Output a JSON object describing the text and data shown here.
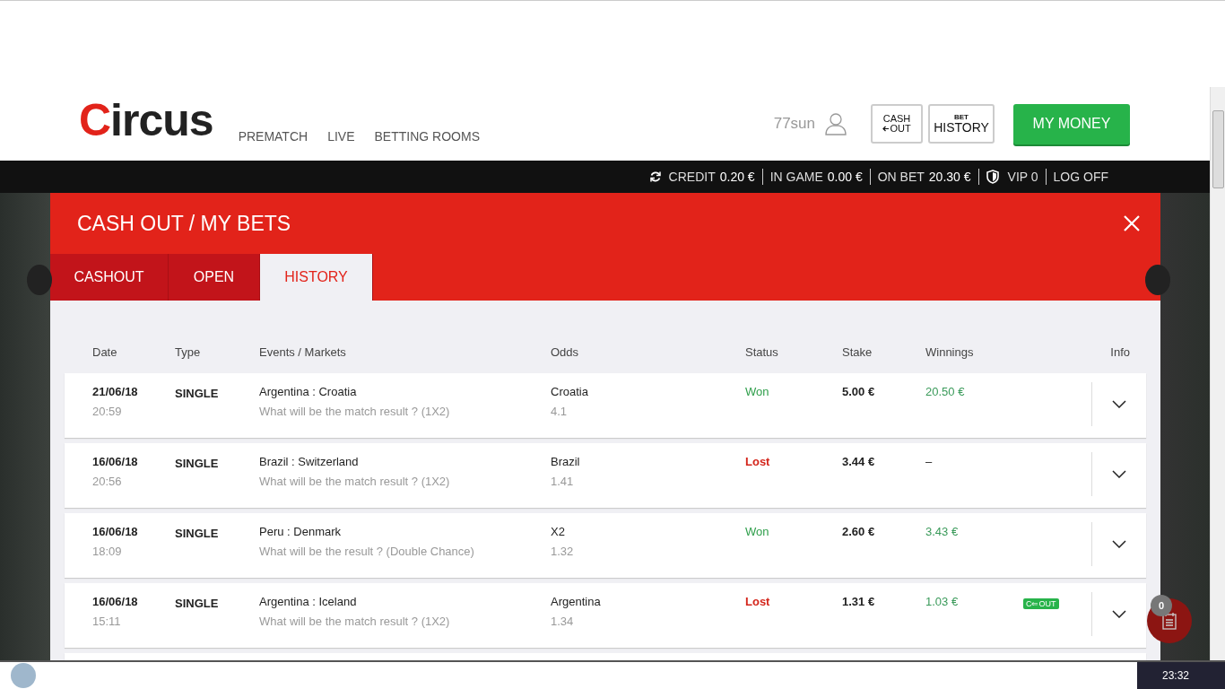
{
  "header": {
    "logo": "Circus",
    "nav": [
      {
        "label": "PREMATCH"
      },
      {
        "label": "LIVE"
      },
      {
        "label": "BETTING ROOMS"
      }
    ],
    "username": "77sun",
    "cashout_button": {
      "top": "CASH",
      "bottom": "OUT"
    },
    "history_button": {
      "top": "BET",
      "bottom": "HISTORY"
    },
    "money_button": "MY MONEY"
  },
  "info_bar": [
    {
      "kind": "amount",
      "label": "CREDIT",
      "value": "0.20 €"
    },
    {
      "kind": "amount",
      "label": "IN GAME",
      "value": "0.00 €"
    },
    {
      "kind": "amount",
      "label": "ON BET",
      "value": "20.30 €"
    },
    {
      "kind": "vip",
      "label": "VIP",
      "value": "0"
    },
    {
      "kind": "link",
      "label": "LOG OFF"
    }
  ],
  "modal": {
    "title": "CASH OUT / MY BETS",
    "tabs": [
      {
        "label": "CASHOUT",
        "selected": false
      },
      {
        "label": "OPEN",
        "selected": false
      },
      {
        "label": "HISTORY",
        "selected": true
      }
    ],
    "columns": [
      "Date",
      "Type",
      "Events / Markets",
      "Odds",
      "Status",
      "Stake",
      "Winnings",
      "Info"
    ],
    "rows": [
      {
        "date": "21/06/18",
        "time": "20:59",
        "type": "SINGLE",
        "event": "Argentina : Croatia",
        "market": "What will be the match result ? (1X2)",
        "pick": "Croatia",
        "odds": "4.1",
        "status": "Won",
        "won": true,
        "stake": "5.00 €",
        "winnings": "20.50 €",
        "paid": true
      },
      {
        "date": "16/06/18",
        "time": "20:56",
        "type": "SINGLE",
        "event": "Brazil : Switzerland",
        "market": "What will be the match result ? (1X2)",
        "pick": "Brazil",
        "odds": "1.41",
        "status": "Lost",
        "won": false,
        "stake": "3.44 €",
        "winnings": "–",
        "paid": false
      },
      {
        "date": "16/06/18",
        "time": "18:09",
        "type": "SINGLE",
        "event": "Peru : Denmark",
        "market": "What will be the result ? (Double Chance)",
        "pick": "X2",
        "odds": "1.32",
        "status": "Won",
        "won": true,
        "stake": "2.60 €",
        "winnings": "3.43 €",
        "paid": true
      },
      {
        "date": "16/06/18",
        "time": "15:11",
        "type": "SINGLE",
        "event": "Argentina : Iceland",
        "market": "What will be the match result ? (1X2)",
        "pick": "Argentina",
        "odds": "1.34",
        "status": "Lost",
        "won": false,
        "stake": "1.31 €",
        "winnings": "1.03 €",
        "paid": true,
        "badge": "C⇐OUT"
      }
    ]
  },
  "betslip_count": "0",
  "taskbar": {
    "clock": "23:32"
  }
}
